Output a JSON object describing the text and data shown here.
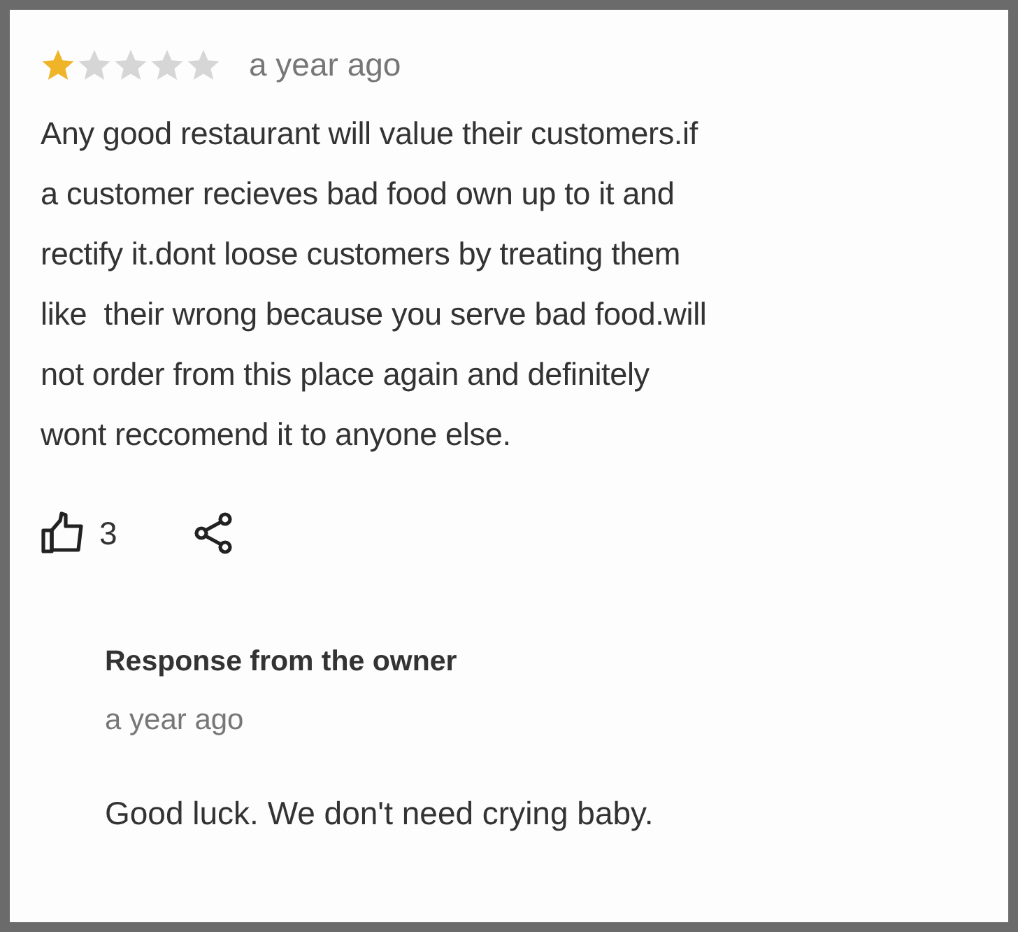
{
  "review": {
    "stars": 1,
    "time": "a year ago",
    "text": "Any good restaurant will value their customers.if\na customer recieves bad food own up to it and\nrectify it.dont loose customers by treating them\nlike  their wrong because you serve bad food.will\nnot order from this place again and definitely\nwont reccomend it to anyone else.",
    "likes": "3"
  },
  "response": {
    "title": "Response from the owner",
    "time": "a year ago",
    "text": "Good luck. We don't need crying baby."
  }
}
